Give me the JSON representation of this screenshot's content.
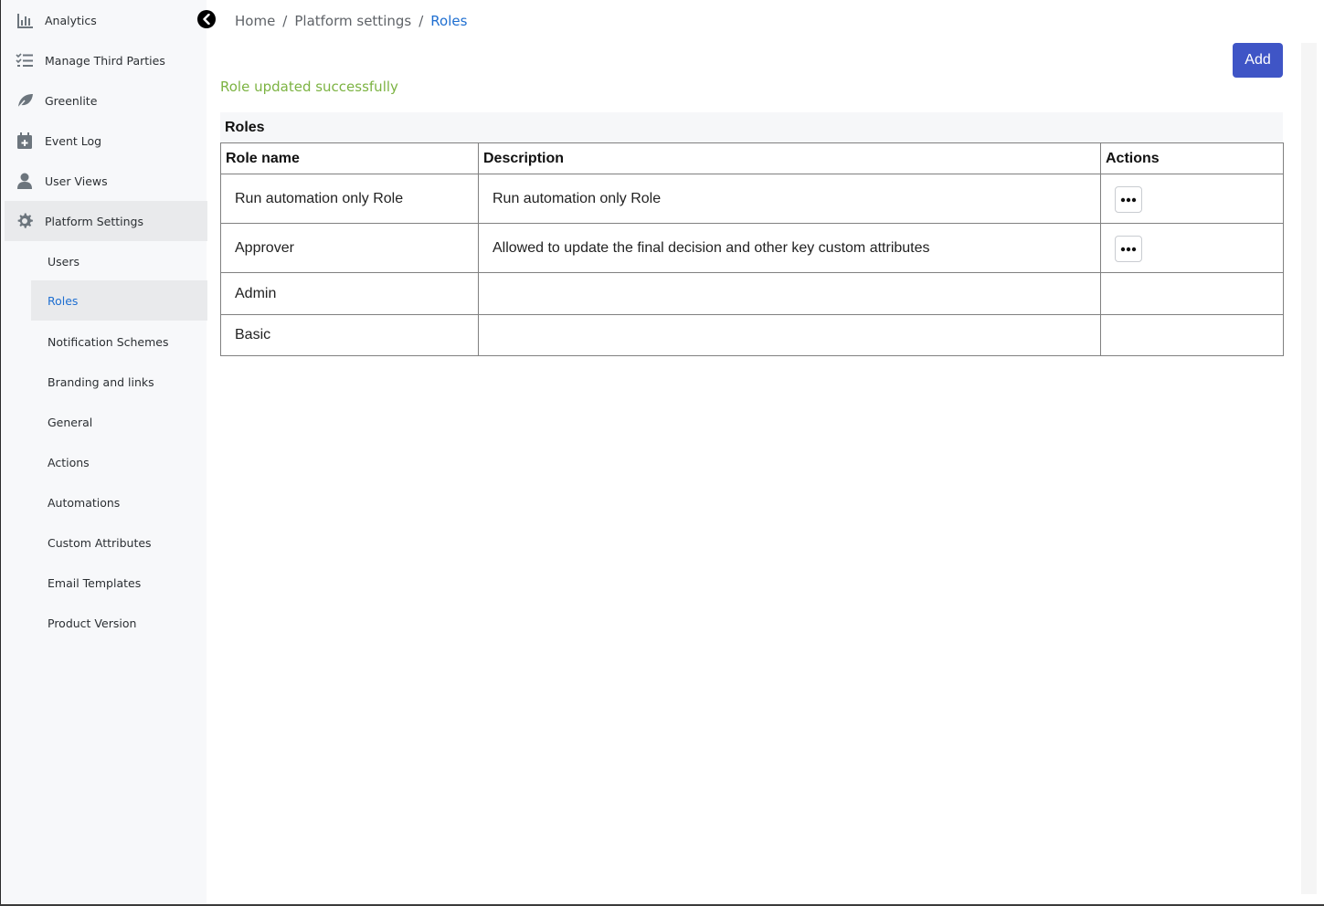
{
  "sidebar": {
    "items": [
      {
        "label": "Analytics",
        "icon": "bar-chart-icon"
      },
      {
        "label": "Manage Third Parties",
        "icon": "list-icon"
      },
      {
        "label": "Greenlite",
        "icon": "leaf-icon"
      },
      {
        "label": "Event Log",
        "icon": "calendar-plus-icon"
      },
      {
        "label": "User Views",
        "icon": "user-icon"
      },
      {
        "label": "Platform Settings",
        "icon": "gear-icon"
      }
    ],
    "sub_items": [
      {
        "label": "Users"
      },
      {
        "label": "Roles"
      },
      {
        "label": "Notification Schemes"
      },
      {
        "label": "Branding and links"
      },
      {
        "label": "General"
      },
      {
        "label": "Actions"
      },
      {
        "label": "Automations"
      },
      {
        "label": "Custom Attributes"
      },
      {
        "label": "Email Templates"
      },
      {
        "label": "Product Version"
      }
    ],
    "active_item": "Platform Settings",
    "active_sub_item": "Roles"
  },
  "breadcrumb": {
    "items": [
      "Home",
      "Platform settings",
      "Roles"
    ],
    "separator": "/"
  },
  "toolbar": {
    "add_label": "Add"
  },
  "message": {
    "success": "Role updated successfully"
  },
  "roles_table": {
    "caption": "Roles",
    "headers": [
      "Role name",
      "Description",
      "Actions"
    ],
    "rows": [
      {
        "name": "Run automation only Role",
        "description": "Run automation only Role",
        "has_actions": true
      },
      {
        "name": "Approver",
        "description": "Allowed to update the final decision and other key custom attributes",
        "has_actions": true
      },
      {
        "name": "Admin",
        "description": "",
        "has_actions": false
      },
      {
        "name": "Basic",
        "description": "",
        "has_actions": false
      }
    ]
  },
  "colors": {
    "primary": "#3f55c6",
    "link": "#1f6fd1",
    "success": "#7cb342",
    "sidebar_bg": "#f7f8fa",
    "active_bg": "#e9eaec"
  }
}
